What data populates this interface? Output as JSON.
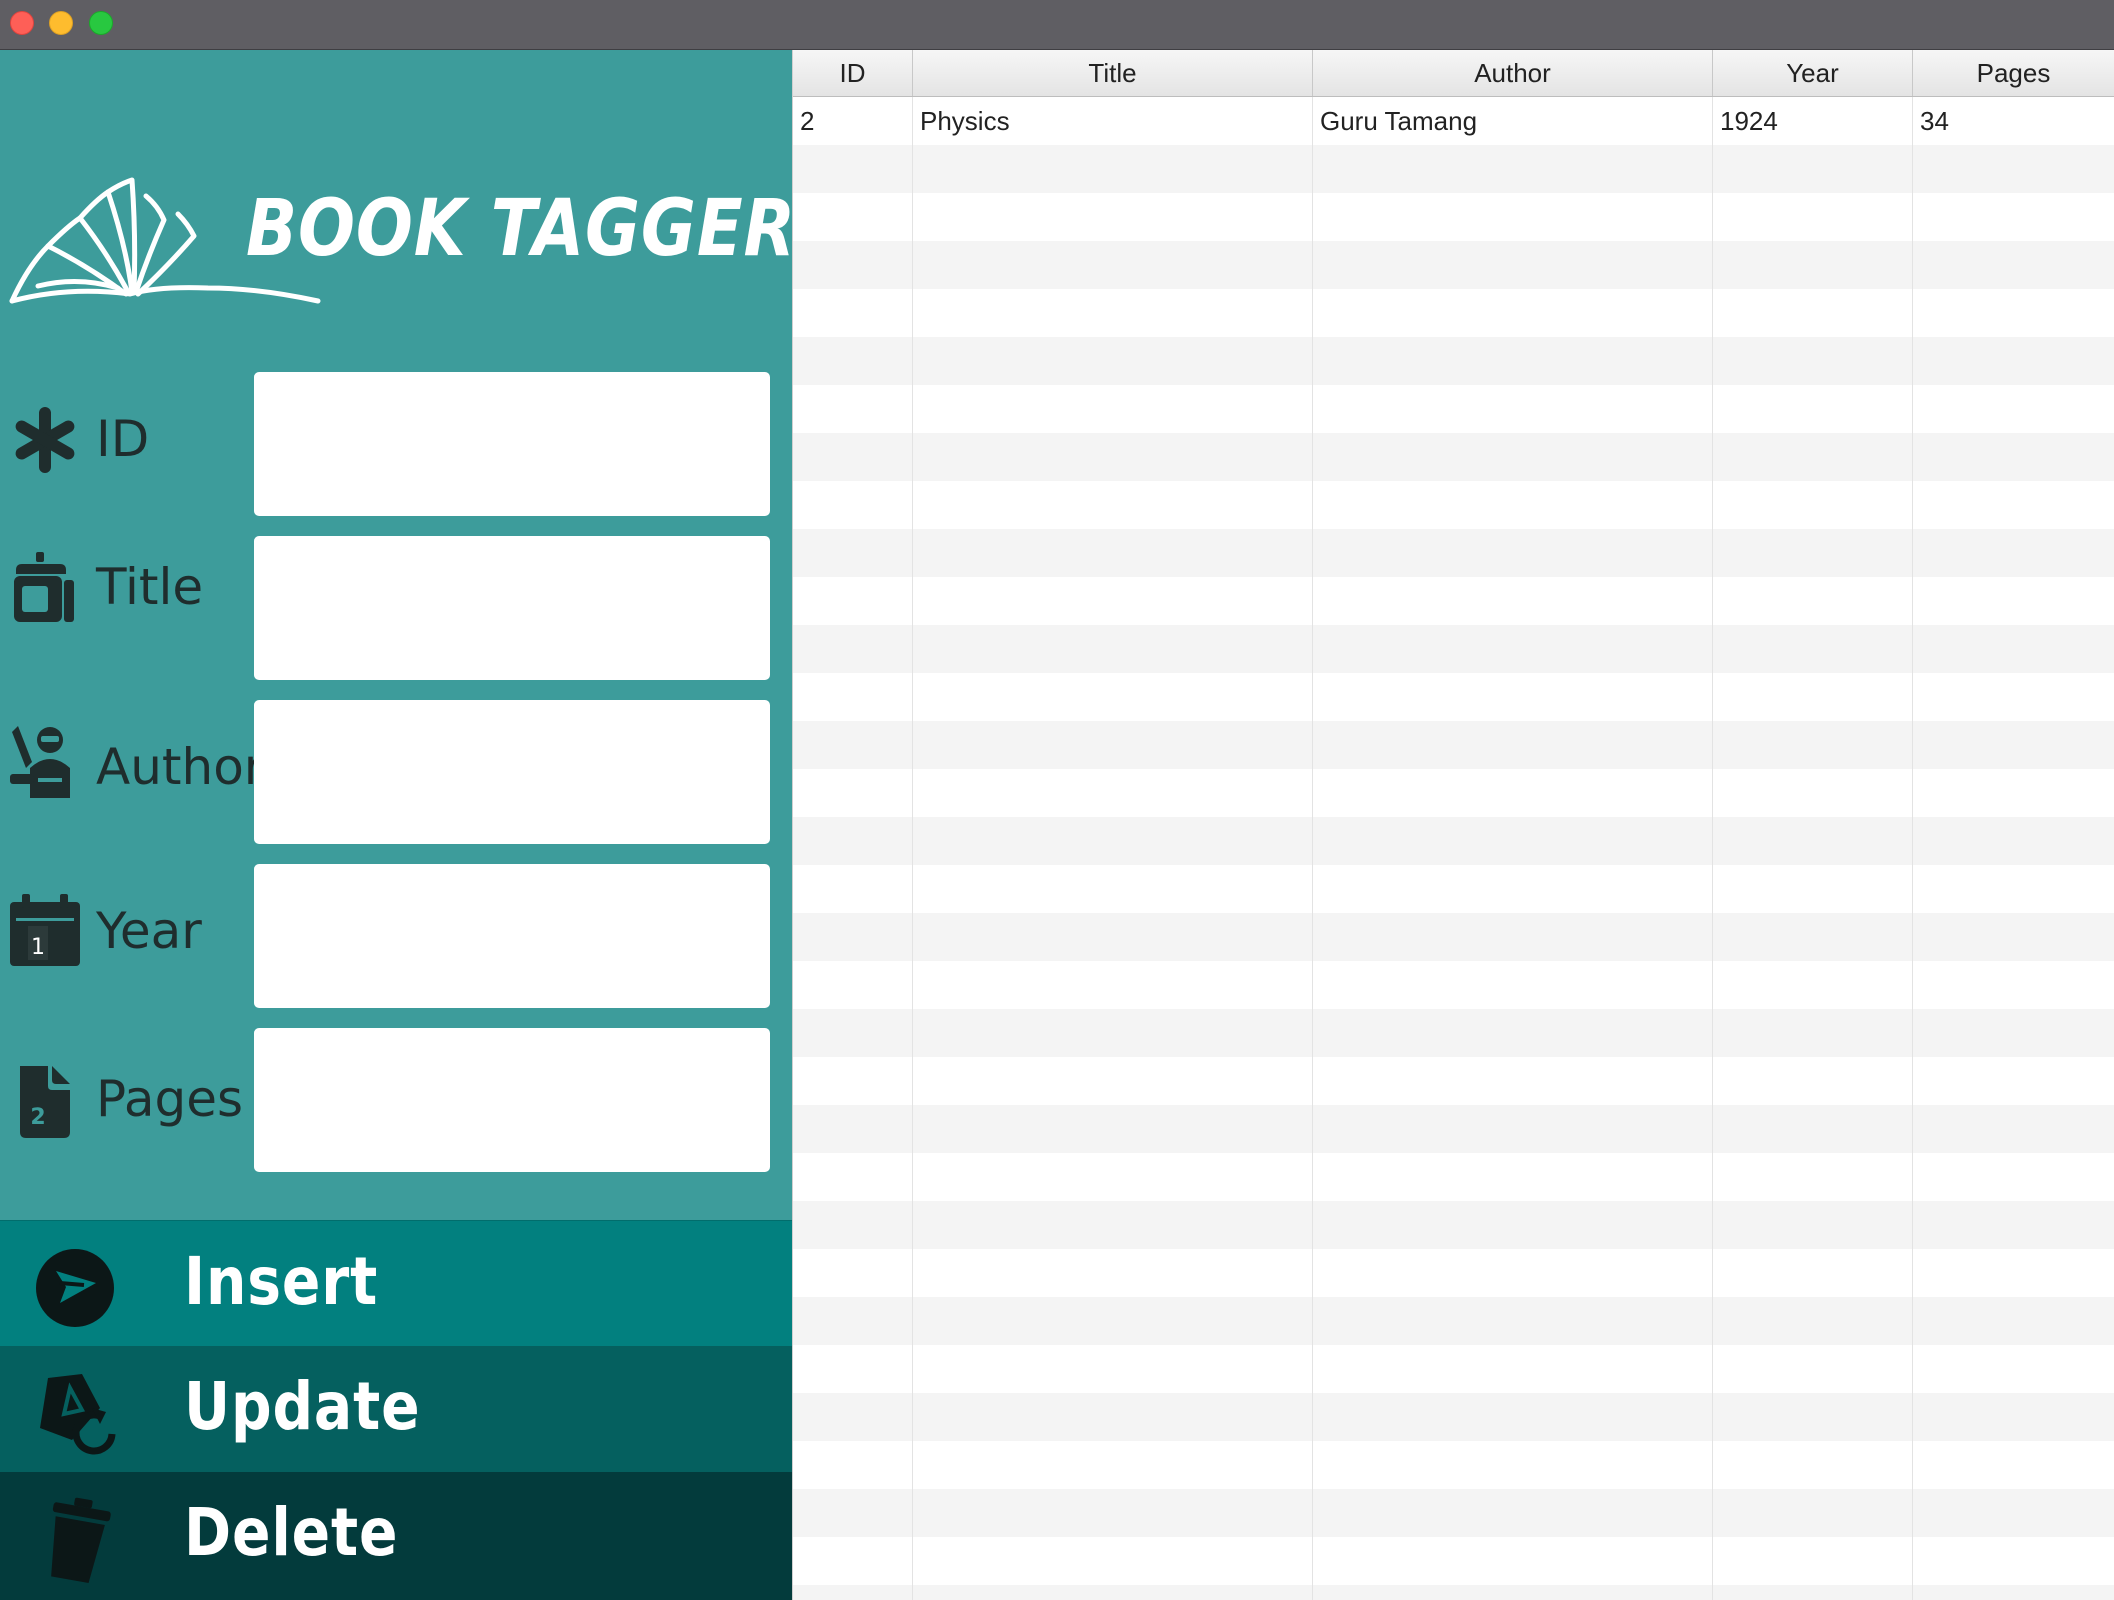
{
  "window": {
    "controls": [
      "close",
      "minimize",
      "zoom"
    ]
  },
  "app": {
    "logo_text": "BOOK TAGGER",
    "logo_icon": "open-book-icon"
  },
  "form": {
    "fields": [
      {
        "key": "id",
        "label": "ID",
        "icon": "asterisk-icon",
        "value": ""
      },
      {
        "key": "title",
        "label": "Title",
        "icon": "title-jar-icon",
        "value": ""
      },
      {
        "key": "author",
        "label": "Author",
        "icon": "author-icon",
        "value": ""
      },
      {
        "key": "year",
        "label": "Year",
        "icon": "calendar-icon",
        "value": ""
      },
      {
        "key": "pages",
        "label": "Pages",
        "icon": "document-icon",
        "value": ""
      }
    ]
  },
  "actions": {
    "insert": {
      "label": "Insert",
      "icon": "send-icon"
    },
    "update": {
      "label": "Update",
      "icon": "refresh-tag-icon"
    },
    "delete": {
      "label": "Delete",
      "icon": "trash-icon"
    }
  },
  "colors": {
    "panel": "#3d9c9b",
    "insert": "#02807f",
    "update": "#05605f",
    "delete": "#033b3c"
  },
  "table": {
    "columns": [
      "ID",
      "Title",
      "Author",
      "Year",
      "Pages"
    ],
    "rows": [
      [
        "2",
        "Physics",
        "Guru Tamang",
        "1924",
        "34"
      ]
    ]
  }
}
